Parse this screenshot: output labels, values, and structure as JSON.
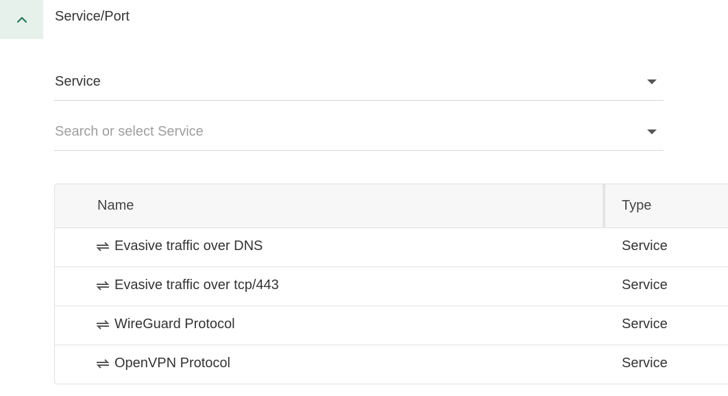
{
  "section": {
    "toggle_icon": "chevron-up-icon",
    "title": "Service/Port"
  },
  "type_select": {
    "value": "Service",
    "icon": "caret-down-icon"
  },
  "search_select": {
    "placeholder": "Search or select Service",
    "icon": "caret-down-icon"
  },
  "table": {
    "columns": [
      "Name",
      "Type"
    ],
    "rows": [
      {
        "icon": "service-transfer-icon",
        "name": "Evasive traffic over DNS",
        "type": "Service"
      },
      {
        "icon": "service-transfer-icon",
        "name": "Evasive traffic over tcp/443",
        "type": "Service"
      },
      {
        "icon": "service-transfer-icon",
        "name": "WireGuard Protocol",
        "type": "Service"
      },
      {
        "icon": "service-transfer-icon",
        "name": "OpenVPN Protocol",
        "type": "Service"
      }
    ]
  },
  "colors": {
    "accent": "#1e7a57",
    "toggle_bg": "#e6f1ec",
    "header_bg": "#f7f7f7"
  }
}
